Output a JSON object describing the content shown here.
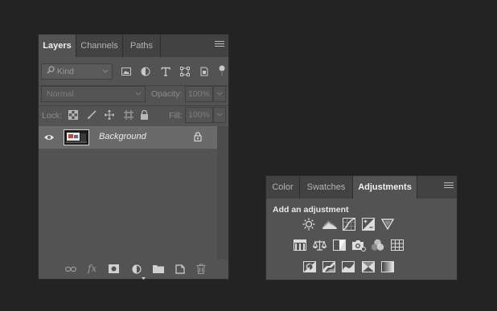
{
  "layers_panel": {
    "tabs": [
      {
        "label": "Layers",
        "active": true
      },
      {
        "label": "Channels",
        "active": false
      },
      {
        "label": "Paths",
        "active": false
      }
    ],
    "filter": {
      "value": "Kind",
      "icon": "search-icon"
    },
    "filter_icons": [
      "pixel-layer-filter-icon",
      "adjustment-layer-filter-icon",
      "type-layer-filter-icon",
      "shape-layer-filter-icon",
      "smart-object-filter-icon"
    ],
    "blend_mode": "Normal",
    "opacity_label": "Opacity:",
    "opacity_value": "100%",
    "lock_label": "Lock:",
    "lock_icons": [
      "lock-transparent-icon",
      "lock-paint-icon",
      "lock-position-icon",
      "lock-artboard-icon",
      "lock-all-icon"
    ],
    "fill_label": "Fill:",
    "fill_value": "100%",
    "layers": [
      {
        "name": "Background",
        "visible": true,
        "locked": true
      }
    ],
    "bottom_icons": [
      "link-layers-icon",
      "fx-icon",
      "add-mask-icon",
      "new-fill-adjustment-icon",
      "new-group-icon",
      "new-layer-icon",
      "delete-layer-icon"
    ],
    "fx_label": "fx"
  },
  "adjustments_panel": {
    "tabs": [
      {
        "label": "Color",
        "active": false
      },
      {
        "label": "Swatches",
        "active": false
      },
      {
        "label": "Adjustments",
        "active": true
      }
    ],
    "title": "Add an adjustment",
    "icon_rows": [
      [
        "brightness-contrast-icon",
        "levels-icon",
        "curves-icon",
        "exposure-icon",
        "vibrance-icon"
      ],
      [
        "hue-saturation-icon",
        "color-balance-icon",
        "black-white-icon",
        "photo-filter-icon",
        "channel-mixer-icon",
        "color-lookup-icon"
      ],
      [
        "invert-icon",
        "posterize-icon",
        "threshold-icon",
        "selective-color-icon",
        "gradient-map-icon"
      ]
    ]
  },
  "colors": {
    "background": "#232323",
    "panel": "#535353",
    "tabbar": "#424242",
    "selected_layer": "#6a6a6a"
  }
}
